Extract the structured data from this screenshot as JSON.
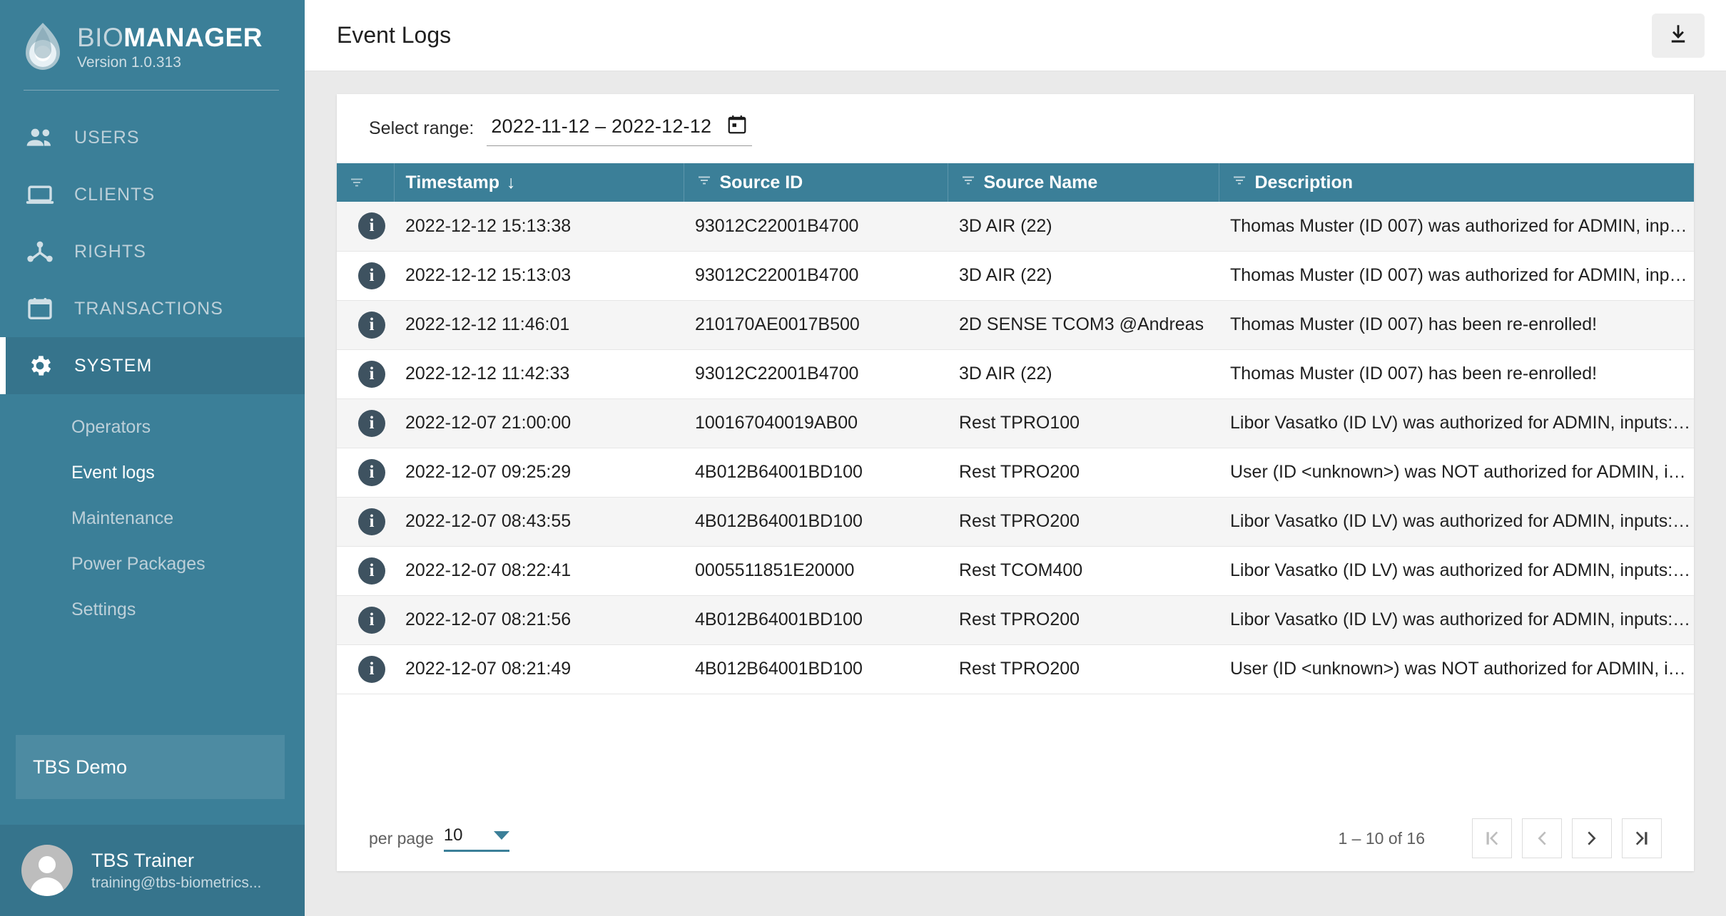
{
  "brand": {
    "title_light": "BIO",
    "title_bold": "MANAGER",
    "version": "Version 1.0.313"
  },
  "sidebar": {
    "nav": [
      {
        "label": "USERS",
        "icon": "people-icon",
        "active": false
      },
      {
        "label": "CLIENTS",
        "icon": "laptop-icon",
        "active": false
      },
      {
        "label": "RIGHTS",
        "icon": "hierarchy-icon",
        "active": false
      },
      {
        "label": "TRANSACTIONS",
        "icon": "calendar-icon",
        "active": false
      },
      {
        "label": "SYSTEM",
        "icon": "gear-icon",
        "active": true
      }
    ],
    "subnav": [
      {
        "label": "Operators",
        "active": false
      },
      {
        "label": "Event logs",
        "active": true
      },
      {
        "label": "Maintenance",
        "active": false
      },
      {
        "label": "Power Packages",
        "active": false
      },
      {
        "label": "Settings",
        "active": false
      }
    ],
    "tenant": "TBS Demo",
    "user": {
      "name": "TBS Trainer",
      "email": "training@tbs-biometrics..."
    }
  },
  "header": {
    "title": "Event Logs",
    "download_icon": "download-icon"
  },
  "range": {
    "label": "Select range:",
    "value": "2022-11-12 – 2022-12-12",
    "calendar_icon": "calendar-icon"
  },
  "table": {
    "columns": [
      {
        "key": "icon",
        "label": "",
        "filter": true,
        "sorted": false
      },
      {
        "key": "timestamp",
        "label": "Timestamp",
        "filter": false,
        "sorted": true,
        "sort_dir": "↓"
      },
      {
        "key": "source_id",
        "label": "Source ID",
        "filter": true,
        "sorted": false
      },
      {
        "key": "source_name",
        "label": "Source Name",
        "filter": true,
        "sorted": false
      },
      {
        "key": "description",
        "label": "Description",
        "filter": true,
        "sorted": false
      }
    ],
    "rows": [
      {
        "icon": "info-icon",
        "timestamp": "2022-12-12 15:13:38",
        "source_id": "93012C22001B4700",
        "source_name": "3D AIR (22)",
        "description": "Thomas Muster (ID 007) was authorized for ADMIN, inp…"
      },
      {
        "icon": "info-icon",
        "timestamp": "2022-12-12 15:13:03",
        "source_id": "93012C22001B4700",
        "source_name": "3D AIR (22)",
        "description": "Thomas Muster (ID 007) was authorized for ADMIN, inp…"
      },
      {
        "icon": "info-icon",
        "timestamp": "2022-12-12 11:46:01",
        "source_id": "210170AE0017B500",
        "source_name": "2D SENSE TCOM3 @Andreas",
        "description": "Thomas Muster (ID 007) has been re-enrolled!"
      },
      {
        "icon": "info-icon",
        "timestamp": "2022-12-12 11:42:33",
        "source_id": "93012C22001B4700",
        "source_name": "3D AIR (22)",
        "description": "Thomas Muster (ID 007) has been re-enrolled!"
      },
      {
        "icon": "info-icon",
        "timestamp": "2022-12-07 21:00:00",
        "source_id": "100167040019AB00",
        "source_name": "Rest TPRO100",
        "description": "Libor Vasatko (ID LV) was authorized for ADMIN, inputs:…"
      },
      {
        "icon": "info-icon",
        "timestamp": "2022-12-07 09:25:29",
        "source_id": "4B012B64001BD100",
        "source_name": "Rest TPRO200",
        "description": "User (ID <unknown>) was NOT authorized for ADMIN, in…"
      },
      {
        "icon": "info-icon",
        "timestamp": "2022-12-07 08:43:55",
        "source_id": "4B012B64001BD100",
        "source_name": "Rest TPRO200",
        "description": "Libor Vasatko (ID LV) was authorized for ADMIN, inputs:…"
      },
      {
        "icon": "info-icon",
        "timestamp": "2022-12-07 08:22:41",
        "source_id": "0005511851E20000",
        "source_name": "Rest TCOM400",
        "description": "Libor Vasatko (ID LV) was authorized for ADMIN, inputs:…"
      },
      {
        "icon": "info-icon",
        "timestamp": "2022-12-07 08:21:56",
        "source_id": "4B012B64001BD100",
        "source_name": "Rest TPRO200",
        "description": "Libor Vasatko (ID LV) was authorized for ADMIN, inputs:…"
      },
      {
        "icon": "info-icon",
        "timestamp": "2022-12-07 08:21:49",
        "source_id": "4B012B64001BD100",
        "source_name": "Rest TPRO200",
        "description": "User (ID <unknown>) was NOT authorized for ADMIN, in…"
      }
    ]
  },
  "footer": {
    "per_page_label": "per page",
    "per_page_value": "10",
    "range_text": "1 – 10 of 16",
    "buttons": [
      {
        "name": "first-page-button",
        "glyph": "|<",
        "disabled": true
      },
      {
        "name": "previous-page-button",
        "glyph": "<",
        "disabled": true
      },
      {
        "name": "next-page-button",
        "glyph": ">",
        "disabled": false
      },
      {
        "name": "last-page-button",
        "glyph": ">|",
        "disabled": false
      }
    ]
  },
  "colors": {
    "sidebar": "#3b7f98",
    "sidebar_active": "#36748c",
    "table_header": "#3b7f98",
    "accent": "#3b7f98",
    "info_badge": "#3e5260"
  }
}
